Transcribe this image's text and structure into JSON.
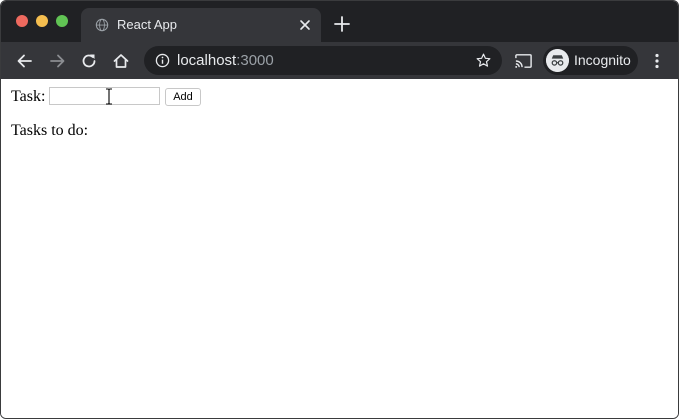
{
  "browser": {
    "tab": {
      "title": "React App"
    },
    "address_bar": {
      "host": "localhost",
      "port": ":3000"
    },
    "profile": {
      "label": "Incognito"
    }
  },
  "page": {
    "task_label": "Task:",
    "task_input": {
      "value": "",
      "placeholder": ""
    },
    "add_button_label": "Add",
    "todo_heading": "Tasks to do:"
  },
  "colors": {
    "chrome_dark": "#202124",
    "chrome_toolbar": "#35363a",
    "chrome_text": "#e8eaed",
    "close_dot": "#ee6a5f",
    "minimize_dot": "#f5be4f",
    "maximize_dot": "#61c454"
  }
}
